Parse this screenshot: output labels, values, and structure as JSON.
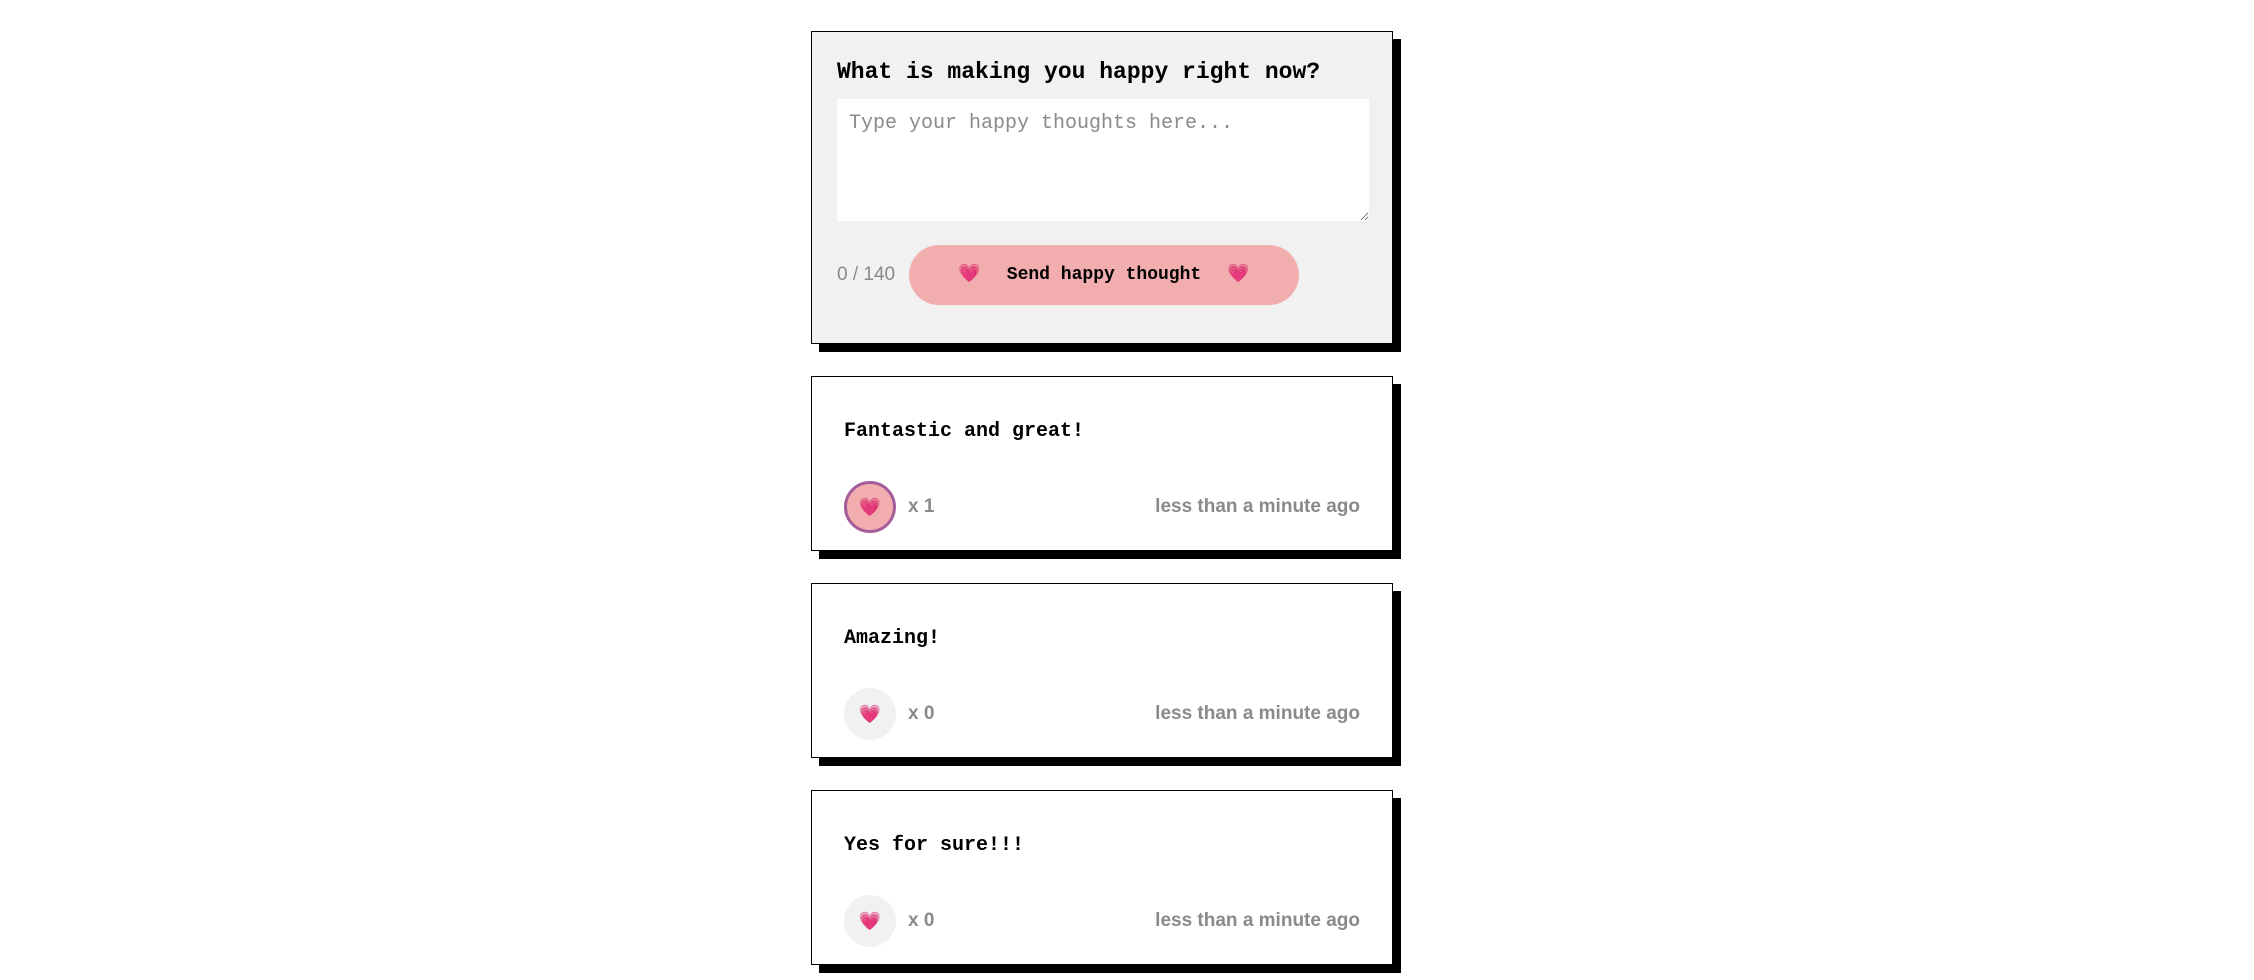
{
  "form": {
    "title": "What is making you happy right now?",
    "placeholder": "Type your happy thoughts here...",
    "value": "",
    "char_count": "0 / 140",
    "send_label": "Send happy thought",
    "heart_glyph": "💗"
  },
  "thoughts": [
    {
      "message": "Fantastic and great!",
      "heart_glyph": "💗",
      "likes": "x 1",
      "liked": true,
      "time": "less than a minute ago"
    },
    {
      "message": "Amazing!",
      "heart_glyph": "💗",
      "likes": "x 0",
      "liked": false,
      "time": "less than a minute ago"
    },
    {
      "message": "Yes for sure!!!",
      "heart_glyph": "💗",
      "likes": "x 0",
      "liked": false,
      "time": "less than a minute ago"
    }
  ],
  "colors": {
    "form_background": "#f1f1f1",
    "button_pink": "#f2aeae",
    "liked_border": "#a55c9a",
    "muted_text": "#8a8a8a",
    "shadow": "#000000"
  }
}
